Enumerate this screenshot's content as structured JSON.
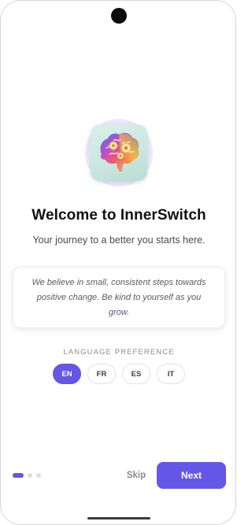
{
  "app": {
    "logo_icon": "brain-gears-logo-icon"
  },
  "welcome": {
    "title": "Welcome to InnerSwitch",
    "subtitle": "Your journey to a better you starts here."
  },
  "quote": {
    "text": "We believe in small, consistent steps towards positive change. Be kind to yourself as you grow."
  },
  "language": {
    "label": "LANGUAGE PREFERENCE",
    "selected": "EN",
    "options": [
      {
        "code": "EN"
      },
      {
        "code": "FR"
      },
      {
        "code": "ES"
      },
      {
        "code": "IT"
      }
    ]
  },
  "pagination": {
    "total_pages": 3,
    "current_page": 1
  },
  "actions": {
    "skip_label": "Skip",
    "next_label": "Next"
  },
  "colors": {
    "accent": "#6456e6",
    "text_primary": "#111114",
    "text_muted": "#8a8a96",
    "background": "#ffffff"
  }
}
